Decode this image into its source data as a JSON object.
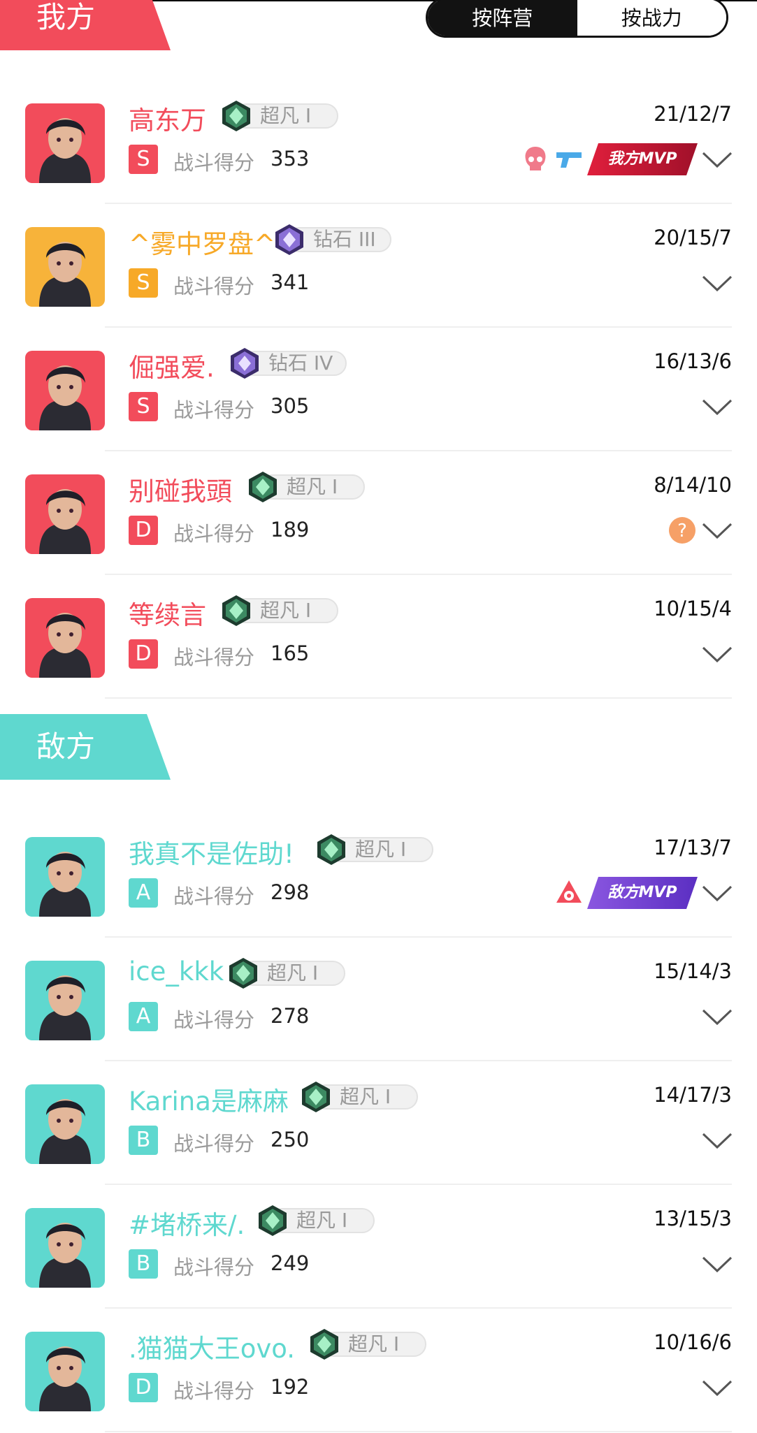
{
  "colors": {
    "ours_accent": "#f24c5b",
    "ours_name_gold": "#f7a928",
    "enemy_accent": "#5fd8cf"
  },
  "toggle": {
    "by_camp": "按阵营",
    "by_power": "按战力"
  },
  "ours": {
    "tab_label": "我方",
    "players": [
      {
        "name": "高东万",
        "name_color": "#f24c5b",
        "rank": "超凡 I",
        "rank_tier": "immortal",
        "kda": "21/12/7",
        "grade": "S",
        "grade_color": "#f24c5b",
        "score_label": "战斗得分",
        "score": "353",
        "avatar_bg": "#f24c5b",
        "mvp_label": "我方MVP",
        "badges": [
          "skull-badge-icon",
          "pistol-badge-icon"
        ]
      },
      {
        "name": "^雾中罗盘^",
        "name_color": "#f7a928",
        "rank": "钻石 III",
        "rank_tier": "diamond",
        "kda": "20/15/7",
        "grade": "S",
        "grade_color": "#f7a928",
        "score_label": "战斗得分",
        "score": "341",
        "avatar_bg": "#f7b33a"
      },
      {
        "name": "倔强爱.",
        "name_color": "#f24c5b",
        "rank": "钻石 IV",
        "rank_tier": "diamond",
        "kda": "16/13/6",
        "grade": "S",
        "grade_color": "#f24c5b",
        "score_label": "战斗得分",
        "score": "305",
        "avatar_bg": "#f24c5b"
      },
      {
        "name": "别碰我頭",
        "name_color": "#f24c5b",
        "rank": "超凡 I",
        "rank_tier": "immortal",
        "kda": "8/14/10",
        "grade": "D",
        "grade_color": "#f24c5b",
        "score_label": "战斗得分",
        "score": "189",
        "avatar_bg": "#f24c5b",
        "badges": [
          "question-badge-icon"
        ]
      },
      {
        "name": "等续言",
        "name_color": "#f24c5b",
        "rank": "超凡 I",
        "rank_tier": "immortal",
        "kda": "10/15/4",
        "grade": "D",
        "grade_color": "#f24c5b",
        "score_label": "战斗得分",
        "score": "165",
        "avatar_bg": "#f24c5b"
      }
    ]
  },
  "enemy": {
    "tab_label": "敌方",
    "players": [
      {
        "name": "我真不是佐助!",
        "name_color": "#5fd8cf",
        "rank": "超凡 I",
        "rank_tier": "immortal",
        "kda": "17/13/7",
        "grade": "A",
        "grade_color": "#5fd8cf",
        "score_label": "战斗得分",
        "score": "298",
        "avatar_bg": "#5fd8cf",
        "mvp_label": "敌方MVP",
        "badges": [
          "target-badge-icon"
        ]
      },
      {
        "name": "ice_kkk",
        "name_color": "#5fd8cf",
        "rank": "超凡 I",
        "rank_tier": "immortal",
        "kda": "15/14/3",
        "grade": "A",
        "grade_color": "#5fd8cf",
        "score_label": "战斗得分",
        "score": "278",
        "avatar_bg": "#5fd8cf"
      },
      {
        "name": "Karina是麻麻",
        "name_color": "#5fd8cf",
        "rank": "超凡 I",
        "rank_tier": "immortal",
        "kda": "14/17/3",
        "grade": "B",
        "grade_color": "#5fd8cf",
        "score_label": "战斗得分",
        "score": "250",
        "avatar_bg": "#5fd8cf"
      },
      {
        "name": "#堵桥来/.",
        "name_color": "#5fd8cf",
        "rank": "超凡 I",
        "rank_tier": "immortal",
        "kda": "13/15/3",
        "grade": "B",
        "grade_color": "#5fd8cf",
        "score_label": "战斗得分",
        "score": "249",
        "avatar_bg": "#5fd8cf"
      },
      {
        "name": ".猫猫大王ovo.",
        "name_color": "#5fd8cf",
        "rank": "超凡 I",
        "rank_tier": "immortal",
        "kda": "10/16/6",
        "grade": "D",
        "grade_color": "#5fd8cf",
        "score_label": "战斗得分",
        "score": "192",
        "avatar_bg": "#5fd8cf"
      }
    ]
  }
}
